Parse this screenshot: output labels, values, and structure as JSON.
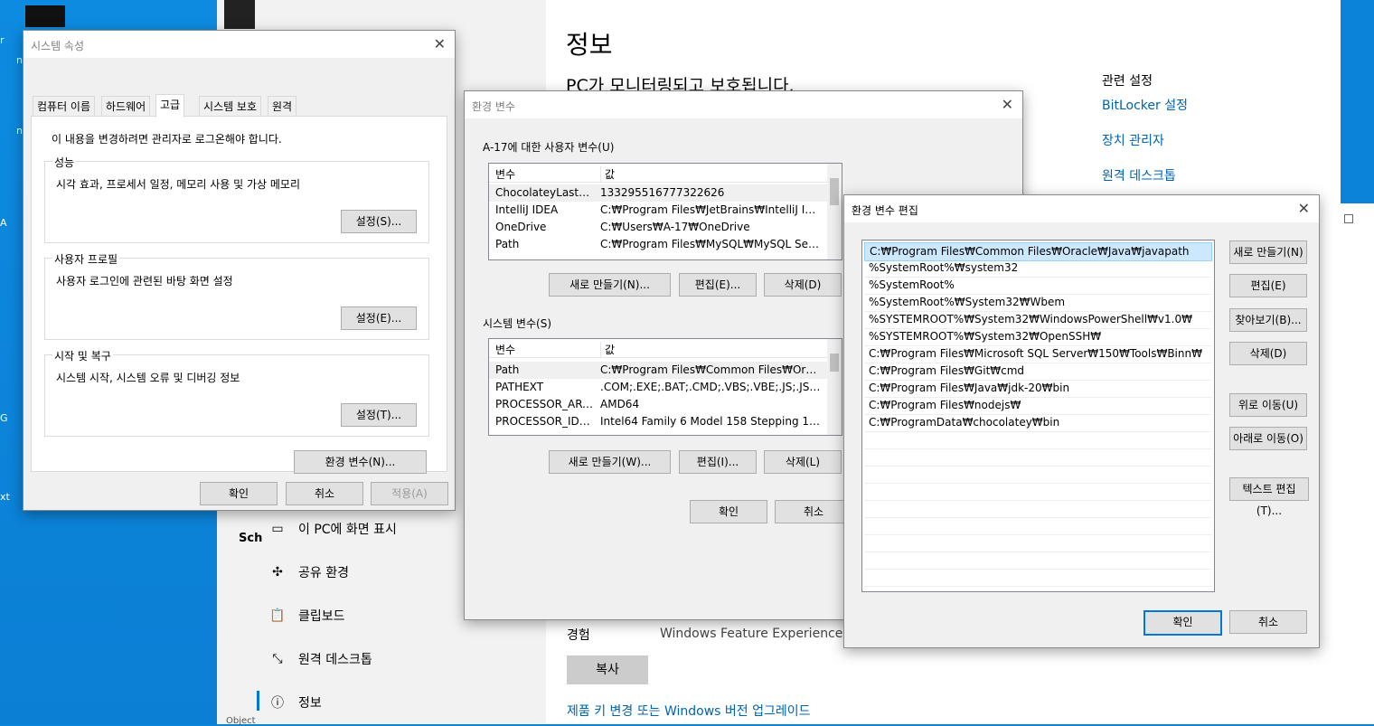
{
  "desktop": {
    "labels": [
      "r",
      "n",
      "n",
      "A",
      "G",
      "xt"
    ]
  },
  "settings": {
    "title": "정보",
    "subtitle": "PC가 모니터링되고 보호됩니다.",
    "related_title": "관련 설정",
    "related_links": [
      "BitLocker 설정",
      "장치 관리자",
      "원격 데스크톱"
    ],
    "nav_items": [
      {
        "label": "이 PC에 화면 표시",
        "icon": "project-icon"
      },
      {
        "label": "공유 환경",
        "icon": "share-icon"
      },
      {
        "label": "클립보드",
        "icon": "clipboard-icon"
      },
      {
        "label": "원격 데스크톱",
        "icon": "remote-icon"
      },
      {
        "label": "정보",
        "icon": "info-icon"
      }
    ],
    "experience_label": "경험",
    "experience_value": "Windows Feature Experience Pa",
    "copy_button": "복사",
    "upgrade_link": "제품 키 변경 또는 Windows 버전 업그레이드",
    "partial_left": "Sch",
    "partial_bottom": "Object"
  },
  "sysprops": {
    "title": "시스템 속성",
    "tabs": [
      "컴퓨터 이름",
      "하드웨어",
      "고급",
      "시스템 보호",
      "원격"
    ],
    "notice": "이 내용을 변경하려면 관리자로 로그온해야 합니다.",
    "perf": {
      "label": "성능",
      "desc": "시각 효과, 프로세서 일정, 메모리 사용 및 가상 메모리",
      "button": "설정(S)..."
    },
    "profile": {
      "label": "사용자 프로필",
      "desc": "사용자 로그인에 관련된 바탕 화면 설정",
      "button": "설정(E)..."
    },
    "startup": {
      "label": "시작 및 복구",
      "desc": "시스템 시작, 시스템 오류 및 디버깅 정보",
      "button": "설정(T)..."
    },
    "env_button": "환경 변수(N)...",
    "ok": "확인",
    "cancel": "취소",
    "apply": "적용(A)"
  },
  "envvars": {
    "title": "환경 변수",
    "user_label": "A-17에 대한 사용자 변수(U)",
    "col_var": "변수",
    "col_val": "값",
    "user_vars": [
      {
        "name": "ChocolateyLastPat...",
        "value": "133295516777322626"
      },
      {
        "name": "IntelliJ IDEA",
        "value": "C:₩Program Files₩JetBrains₩IntelliJ IDEA 2..."
      },
      {
        "name": "OneDrive",
        "value": "C:₩Users₩A-17₩OneDrive"
      },
      {
        "name": "Path",
        "value": "C:₩Program Files₩MySQL₩MySQL Server ..."
      }
    ],
    "user_buttons": [
      "새로 만들기(N)...",
      "편집(E)...",
      "삭제(D)"
    ],
    "sys_label": "시스템 변수(S)",
    "sys_vars": [
      {
        "name": "Path",
        "value": "C:₩Program Files₩Common Files₩Oracle₩..."
      },
      {
        "name": "PATHEXT",
        "value": ".COM;.EXE;.BAT;.CMD;.VBS;.VBE;.JS;.JSE;.W..."
      },
      {
        "name": "PROCESSOR_ARC...",
        "value": "AMD64"
      },
      {
        "name": "PROCESSOR_IDEN...",
        "value": "Intel64 Family 6 Model 158 Stepping 10, ..."
      }
    ],
    "sys_buttons": [
      "새로 만들기(W)...",
      "편집(I)...",
      "삭제(L)"
    ],
    "ok": "확인",
    "cancel": "취소"
  },
  "editenv": {
    "title": "환경 변수 편집",
    "paths": [
      "C:₩Program Files₩Common Files₩Oracle₩Java₩javapath",
      "%SystemRoot%₩system32",
      "%SystemRoot%",
      "%SystemRoot%₩System32₩Wbem",
      "%SYSTEMROOT%₩System32₩WindowsPowerShell₩v1.0₩",
      "%SYSTEMROOT%₩System32₩OpenSSH₩",
      "C:₩Program Files₩Microsoft SQL Server₩150₩Tools₩Binn₩",
      "C:₩Program Files₩Git₩cmd",
      "C:₩Program Files₩Java₩jdk-20₩bin",
      "C:₩Program Files₩nodejs₩",
      "C:₩ProgramData₩chocolatey₩bin"
    ],
    "buttons": [
      "새로 만들기(N)",
      "편집(E)",
      "찾아보기(B)...",
      "삭제(D)",
      "위로 이동(U)",
      "아래로 이동(O)",
      "텍스트 편집(T)..."
    ],
    "ok": "확인",
    "cancel": "취소"
  }
}
